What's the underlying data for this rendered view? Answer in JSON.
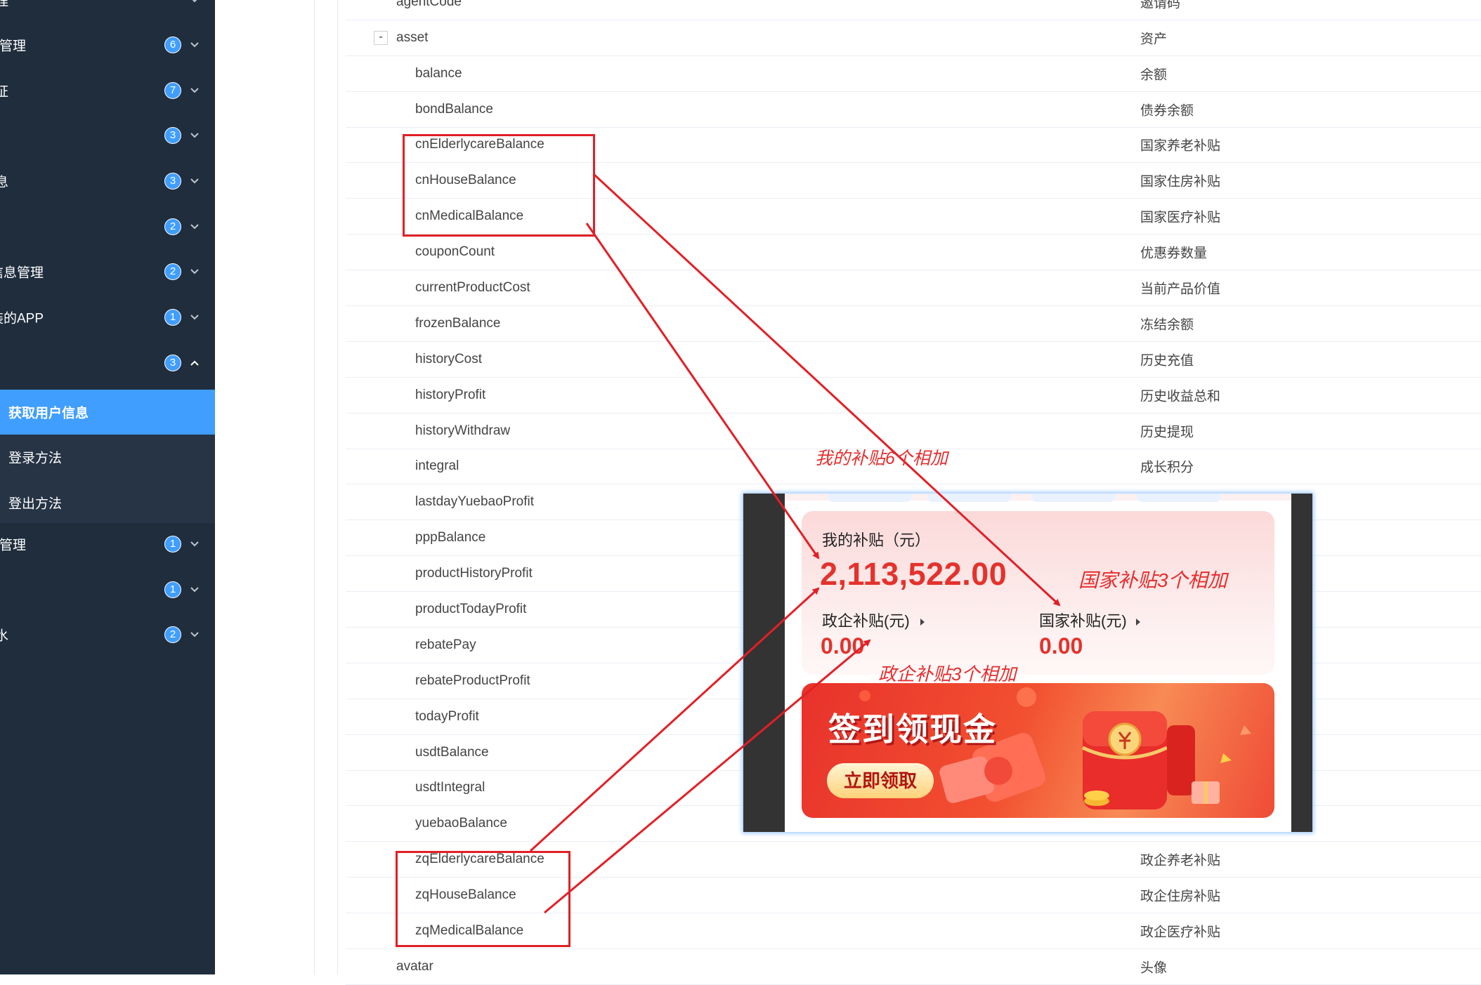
{
  "sidebar": {
    "items": [
      {
        "label": "理",
        "badge": ""
      },
      {
        "label": "息管理",
        "badge": "6"
      },
      {
        "label": "证",
        "badge": "7"
      },
      {
        "label": "",
        "badge": "3"
      },
      {
        "label": "息",
        "badge": "3"
      },
      {
        "label": "",
        "badge": "2"
      },
      {
        "label": "址信息管理",
        "badge": "2"
      },
      {
        "label": "安装的APP",
        "badge": "1"
      },
      {
        "label": "",
        "badge": "3"
      }
    ],
    "submenu": [
      {
        "label": "获取用户信息",
        "active": true
      },
      {
        "label": "登录方法"
      },
      {
        "label": "登出方法"
      }
    ],
    "items_after": [
      {
        "label": "息管理",
        "badge": "1"
      },
      {
        "label": "",
        "badge": "1"
      },
      {
        "label": "水",
        "badge": "2"
      }
    ],
    "colors": {
      "bg": "#1f2d3d",
      "submenu_bg": "#263445",
      "active": "#409eff"
    }
  },
  "table": {
    "rows": [
      {
        "field": "agentCode",
        "desc": "邀请码"
      },
      {
        "field": "asset",
        "desc": "资产",
        "toggle": "-"
      },
      {
        "field": "balance",
        "desc": "余额"
      },
      {
        "field": "bondBalance",
        "desc": "债券余额"
      },
      {
        "field": "cnElderlycareBalance",
        "desc": "国家养老补贴"
      },
      {
        "field": "cnHouseBalance",
        "desc": "国家住房补贴"
      },
      {
        "field": "cnMedicalBalance",
        "desc": "国家医疗补贴"
      },
      {
        "field": "couponCount",
        "desc": "优惠券数量"
      },
      {
        "field": "currentProductCost",
        "desc": "当前产品价值"
      },
      {
        "field": "frozenBalance",
        "desc": "冻结余额"
      },
      {
        "field": "historyCost",
        "desc": "历史充值"
      },
      {
        "field": "historyProfit",
        "desc": "历史收益总和"
      },
      {
        "field": "historyWithdraw",
        "desc": "历史提现"
      },
      {
        "field": "integral",
        "desc": "成长积分"
      },
      {
        "field": "lastdayYuebaoProfit",
        "desc": ""
      },
      {
        "field": "pppBalance",
        "desc": ""
      },
      {
        "field": "productHistoryProfit",
        "desc": ""
      },
      {
        "field": "productTodayProfit",
        "desc": ""
      },
      {
        "field": "rebatePay",
        "desc": ""
      },
      {
        "field": "rebateProductProfit",
        "desc": ""
      },
      {
        "field": "todayProfit",
        "desc": ""
      },
      {
        "field": "usdtBalance",
        "desc": ""
      },
      {
        "field": "usdtIntegral",
        "desc": ""
      },
      {
        "field": "yuebaoBalance",
        "desc": ""
      },
      {
        "field": "zqElderlycareBalance",
        "desc": "政企养老补贴"
      },
      {
        "field": "zqHouseBalance",
        "desc": "政企住房补贴"
      },
      {
        "field": "zqMedicalBalance",
        "desc": "政企医疗补贴"
      },
      {
        "field": "avatar",
        "desc": "头像"
      }
    ]
  },
  "phone": {
    "card_title": "我的补贴（元）",
    "total": "2,113,522.00",
    "gov_ent_label": "政企补贴(元)",
    "gov_ent_value": "0.00",
    "national_label": "国家补贴(元)",
    "national_value": "0.00",
    "banner_title": "签到领现金",
    "banner_button": "立即领取"
  },
  "annotations": {
    "my_subsidy": "我的补贴6个相加",
    "national": "国家补贴3个相加",
    "gov_ent": "政企补贴3个相加",
    "color": "#e62e2e"
  }
}
